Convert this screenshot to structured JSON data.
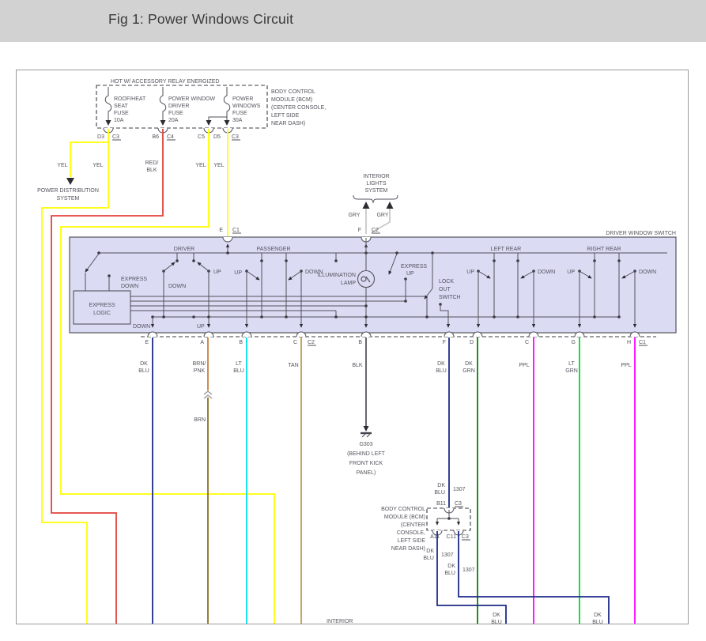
{
  "header": {
    "title": "Fig 1: Power Windows Circuit"
  },
  "colors": {
    "yellow": "#ffff00",
    "red": "#e2423c",
    "gray_wire": "#c8c8c8",
    "dk_blu": "#1d2b87",
    "brn_pnk": "#c77f3d",
    "brn": "#8e6d1d",
    "lt_blu": "#00e0ee",
    "tan": "#bd9e4b",
    "blk": "#55555d",
    "dk_grn": "#0b8008",
    "ppl": "#ff00ff",
    "lt_grn": "#00d92c",
    "box_fill": "#dbdbf4",
    "line": "#50505a"
  },
  "fusebox": {
    "banner": "HOT W/ ACCESSORY RELAY ENERGIZED",
    "fuse1": [
      "ROOF/HEAT",
      "SEAT",
      "FUSE",
      "10A"
    ],
    "fuse2": [
      "POWER WINDOW",
      "DRIVER",
      "FUSE",
      "20A"
    ],
    "fuse3": [
      "POWER",
      "WINDOWS",
      "FUSE",
      "30A"
    ],
    "pins": [
      "D3",
      "C3",
      "B6",
      "C4",
      "C5",
      "D5",
      "C3"
    ]
  },
  "bcm_top": {
    "lines": [
      "BODY CONTROL",
      "MODULE (BCM)",
      "(CENTER CONSOLE,",
      "LEFT SIDE",
      "NEAR DASH)"
    ]
  },
  "top_wires": {
    "yel1": "YEL",
    "yel2": "YEL",
    "red1": "RED/",
    "red2": "BLK",
    "yel3": "YEL",
    "yel4": "YEL"
  },
  "power_dist": {
    "l1": "POWER DISTRIBUTION",
    "l2": "SYSTEM"
  },
  "interior_lights": {
    "l1": "INTERIOR",
    "l2": "LIGHTS",
    "l3": "SYSTEM",
    "gry1": "GRY",
    "gry2": "GRY",
    "pin": "F",
    "ref": "C2"
  },
  "entry_e": {
    "pin": "E",
    "ref": "C1"
  },
  "switchbox": {
    "title": "DRIVER WINDOW SWITCH",
    "sec1": "DRIVER",
    "sec2": "PASSENGER",
    "sec3": "LEFT REAR",
    "sec4": "RIGHT REAR",
    "exdown1": "EXPRESS",
    "exdown2": "DOWN",
    "logic1": "EXPRESS",
    "logic2": "LOGIC",
    "down_drv": "DOWN",
    "up_drv": "UP",
    "up_pas": "UP",
    "down_pas": "DOWN",
    "illum1": "ILLUMINATION",
    "illum2": "LAMP",
    "exup1": "EXPRESS",
    "exup2": "UP",
    "lock1": "LOCK",
    "lock2": "OUT",
    "lock3": "SWITCH",
    "up_lr": "UP",
    "down_lr": "DOWN",
    "up_rr": "UP",
    "down_rr": "DOWN",
    "out_down": "DOWN",
    "out_up": "UP"
  },
  "connectors": {
    "letters": [
      "E",
      "A",
      "B",
      "C",
      "B",
      "F",
      "D",
      "C",
      "G",
      "H"
    ],
    "ref_c2": "C2",
    "ref_c1": "C1"
  },
  "wirecolors": [
    [
      "DK",
      "BLU"
    ],
    [
      "BRN/",
      "PNK"
    ],
    [
      "LT",
      "BLU"
    ],
    [
      "TAN"
    ],
    [
      "BLK"
    ],
    [
      "DK",
      "BLU"
    ],
    [
      "DK",
      "GRN"
    ],
    [
      "PPL"
    ],
    [
      "LT",
      "GRN"
    ],
    [
      "PPL"
    ]
  ],
  "brn": "BRN",
  "ground": [
    "G303",
    "(BEHIND LEFT",
    "FRONT KICK",
    "PANEL)"
  ],
  "bcm": {
    "wire_top1": "DK",
    "wire_top2": "BLU",
    "ckt_top": "1307",
    "pin_b11": "B11",
    "ref_top": "C3",
    "lines": [
      "BODY CONTROL",
      "MODULE (BCM)",
      "(CENTER",
      "CONSOLE,",
      "LEFT SIDE",
      "NEAR DASH)"
    ],
    "pin_a11": "A11",
    "pin_c11": "C11",
    "ref_bot": "C3",
    "wire_a1": "DK",
    "wire_a2": "BLU",
    "ckt_a": "1307",
    "wire_c1": "DK",
    "wire_c2": "BLU",
    "ckt_c": "1307"
  },
  "bottom": {
    "interior": "INTERIOR",
    "dkblu_a1": "DK",
    "dkblu_a2": "BLU",
    "dkblu_c1": "DK",
    "dkblu_c2": "BLU"
  }
}
